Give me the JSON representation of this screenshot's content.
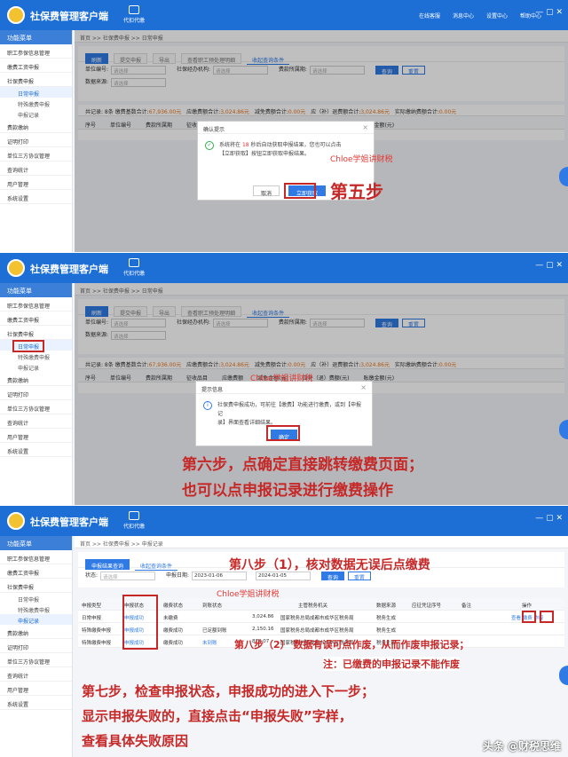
{
  "app": {
    "title": "社保费管理客户端",
    "proxy_label": "代扣代缴",
    "tools": [
      "在线客服",
      "消息中心",
      "设置中心",
      "帮助中心"
    ],
    "menu_head": "功能菜单",
    "menu": [
      "职工参保信息管理",
      "缴费工资申报",
      "社保费申报",
      "日常申报",
      "特殊缴费申报",
      "申报记录",
      "费款缴纳",
      "证明打印",
      "单位三方协议管理",
      "查询统计",
      "用户管理",
      "系统设置"
    ]
  },
  "panel1": {
    "breadcrumb": "首页 >> 社保费申报 >> 日常申报",
    "tabs": [
      "刷新",
      "提交申报",
      "导出",
      "查看职工预处理明细",
      "收起查询条件"
    ],
    "filters": [
      {
        "label": "单位编号:",
        "placeholder": "请选择"
      },
      {
        "label": "社保经办机构:",
        "placeholder": "请选择"
      },
      {
        "label": "费款所属期:",
        "placeholder": "请选择"
      }
    ],
    "data_source": {
      "label": "数据来源:",
      "placeholder": "请选择"
    },
    "query": "查询",
    "reset": "重置",
    "summary": {
      "count": "共记录: 8条",
      "base_label": "缴费基数合计:",
      "base": "67,936.00元",
      "due_label": "应缴费额合计:",
      "due": "3,024.86元",
      "relief_label": "减免费额合计:",
      "relief": "0.00元",
      "supp_label": "应（补）退费额合计:",
      "supp": "3,024.86元",
      "paid_label": "实际缴纳费额合计:",
      "paid": "0.00元"
    },
    "columns": [
      "序号",
      "单位编号",
      "费款所属期",
      "征收品目",
      "应缴费额",
      "减免金额(元)",
      "应补（退）费额(元)",
      "账缴金额(元)"
    ],
    "dialog": {
      "title": "确认提示",
      "line1": "系统将在",
      "seconds": "18",
      "line1b": "秒后自动获取申报结果，您也可以点击",
      "line2": "【立即获取】按钮立即获取申报结果。",
      "cancel": "取消",
      "confirm": "立即获取"
    },
    "watermark": "Chloe学姐讲财税",
    "step": "第五步"
  },
  "panel2": {
    "breadcrumb": "首页 >> 社保费申报 >> 日常申报",
    "tabs": [
      "刷新",
      "提交申报",
      "导出",
      "查看职工预处理明细",
      "收起查询条件"
    ],
    "summary": {
      "base": "67,936.00元",
      "due": "3,024.86元",
      "relief": "0.00元",
      "supp": "3,024.86元",
      "paid": "0.00元"
    },
    "dialog": {
      "title": "提示信息",
      "line1": "社保费申报成功，可前往【缴费】功能进行缴费，或到【申报记",
      "line2": "录】界面查看详细结果。",
      "confirm": "确定"
    },
    "watermark": "Chloe学姐讲财税",
    "step_line1": "第六步，点确定直接跳转缴费页面；",
    "step_line2": "也可以点申报记录进行缴费操作"
  },
  "panel3": {
    "breadcrumb": "首页 >> 社保费申报 >> 申报记录",
    "tabs": [
      "申报结果查询",
      "收起查询条件"
    ],
    "status_label": "状态:",
    "status_placeholder": "请选择",
    "date_label": "申报日期:",
    "date_from": "2023-01-06",
    "date_to": "2024-01-05",
    "query": "查询",
    "reset": "重置",
    "columns": [
      "申报类型",
      "申报状态",
      "缴费状态",
      "到账状态",
      "主管税务机关",
      "数据来源",
      "应征凭证序号",
      "备注",
      "操作"
    ],
    "rows": [
      {
        "type": "日常申报",
        "status": "申报成功",
        "pay": "未缴费",
        "arrive": "",
        "amount": "3,024.86",
        "office": "国家税务总局成都市成华区税务局",
        "source": "税务生成",
        "actions": "查看 缴费 作废"
      },
      {
        "type": "特殊缴费申报",
        "status": "申报成功",
        "pay": "缴费成功",
        "arrive": "已足额到账",
        "amount": "2,150.16",
        "office": "国家税务总局成都市成华区税务局",
        "source": "税务生成",
        "actions": ""
      },
      {
        "type": "特殊缴费申报",
        "status": "申报成功",
        "pay": "缴费成功",
        "arrive": "未到账",
        "amount": "874.07",
        "office": "国家税务总局成都市成华区税务局",
        "source": "税务生成",
        "actions": ""
      }
    ],
    "watermark": "Chloe学姐讲财税",
    "step8a": "第八步（1），核对数据无误后点缴费",
    "step8b": "第八步（2）  数据有误可点作废，从而作废申报记录；",
    "step8c": "注：已缴费的申报记录不能作废",
    "step7_line1": "第七步，检查申报状态，申报成功的进入下一步；",
    "step7_line2": "显示申报失败的，直接点击“申报失败”字样，",
    "step7_line3": "查看具体失败原因",
    "footer": "头条 @财税思维"
  }
}
